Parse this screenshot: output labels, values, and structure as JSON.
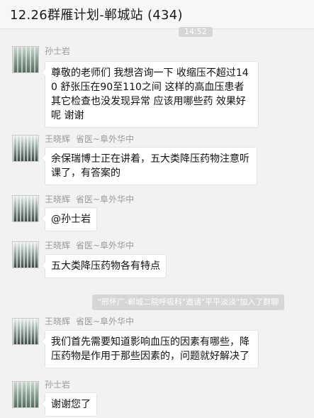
{
  "header": {
    "title": "12.26群雁计划-郸城站 (434)"
  },
  "timestamp": "14:52",
  "system_notice": "\"邢怀广-郸城二院呼吸科\"邀请\"平平淡淡\"加入了群聊",
  "messages": [
    {
      "sender": "孙士岩",
      "role": "",
      "avatar": "landscape-avatar",
      "text": "尊敬的老师们 我想咨询一下 收缩压不超过140 舒张压在90至110之间 这样的高血压患者其它检查也没发现异常 应该用哪些药 效果好呢 谢谢"
    },
    {
      "sender": "王晓辉",
      "role": "省医~阜外华中",
      "avatar": "building-avatar",
      "text": "余保瑞博士正在讲着，五大类降压药物注意听课了，有答案的"
    },
    {
      "sender": "王晓辉",
      "role": "省医~阜外华中",
      "avatar": "building-avatar",
      "text": "@孙士岩"
    },
    {
      "sender": "王晓辉",
      "role": "省医~阜外华中",
      "avatar": "building-avatar",
      "text": "五大类降压药物各有特点"
    },
    {
      "sender": "王晓辉",
      "role": "省医~阜外华中",
      "avatar": "building-avatar",
      "text": "我们首先需要知道影响血压的因素有哪些，降压药物是作用于那些因素的，问题就好解决了"
    },
    {
      "sender": "孙士岩",
      "role": "",
      "avatar": "landscape-avatar",
      "text": "谢谢您了"
    }
  ]
}
